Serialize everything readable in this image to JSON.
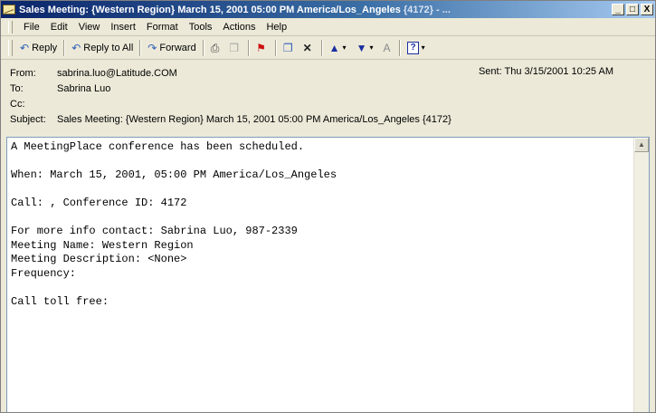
{
  "window": {
    "title": "Sales Meeting: {Western Region} March 15, 2001 05:00 PM America/Los_Angeles",
    "title_tail": "{4172} - ...",
    "buttons": {
      "minimize": "_",
      "maximize": "□",
      "close": "X"
    }
  },
  "menu": [
    "File",
    "Edit",
    "View",
    "Insert",
    "Format",
    "Tools",
    "Actions",
    "Help"
  ],
  "toolbar": {
    "reply": "Reply",
    "reply_all": "Reply to All",
    "forward": "Forward"
  },
  "header": {
    "from_label": "From:",
    "from_value": "sabrina.luo@Latitude.COM",
    "to_label": "To:",
    "to_value": "Sabrina Luo",
    "cc_label": "Cc:",
    "cc_value": "",
    "sent_label": "Sent:",
    "sent_value": "Thu 3/15/2001 10:25 AM",
    "subject_label": "Subject:",
    "subject_value": "Sales Meeting: {Western Region} March 15, 2001 05:00 PM America/Los_Angeles {4172}"
  },
  "body": {
    "lines": [
      "A MeetingPlace conference has been scheduled.",
      "",
      "When: March 15, 2001, 05:00 PM America/Los_Angeles",
      "",
      "Call: , Conference ID: 4172",
      "",
      "For more info contact: Sabrina Luo, 987-2339",
      "Meeting Name: Western Region",
      "Meeting Description: <None>",
      "Frequency:",
      "",
      "Call toll free:"
    ]
  },
  "icons": {
    "reply": "reply-icon",
    "reply_all": "reply-all-icon",
    "forward": "forward-icon",
    "print": "print-icon",
    "copy": "copy-icon",
    "flag": "flag-icon",
    "move": "move-to-folder-icon",
    "delete": "delete-icon",
    "previous": "previous-item-icon",
    "next": "next-item-icon",
    "font_size": "font-size-icon",
    "help": "help-icon"
  }
}
